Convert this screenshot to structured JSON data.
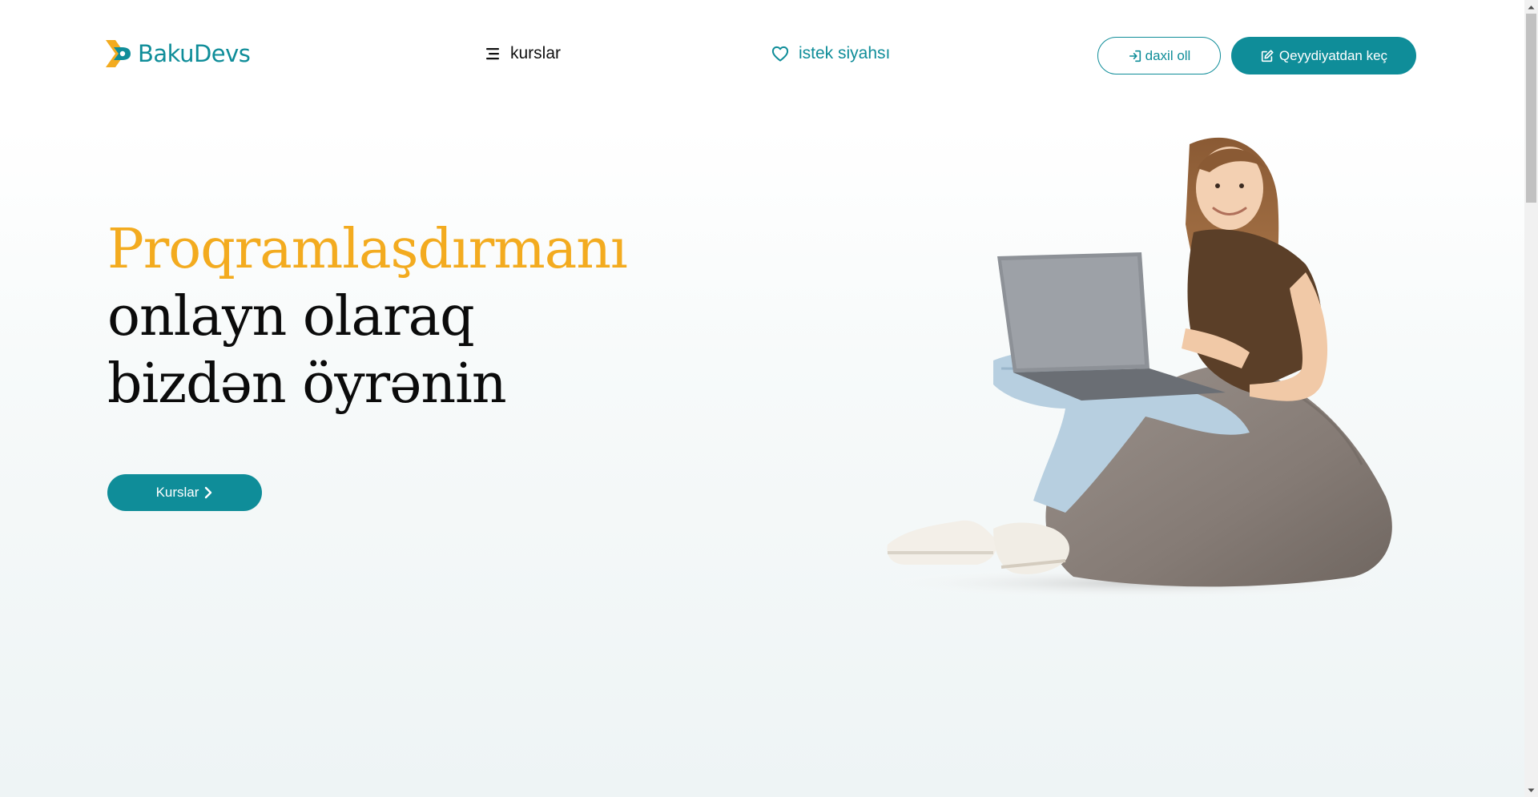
{
  "brand": {
    "name": "BakuDevs",
    "primary_color": "#0f8d99",
    "accent_color": "#f3ab1f"
  },
  "header": {
    "courses_label": "kurslar",
    "courses_icon": "menu-icon",
    "wishlist_label": "istek siyahsı",
    "wishlist_icon": "heart-icon",
    "login_label": "daxil oll",
    "login_icon": "sign-in-icon",
    "register_label": "Qeyydiyatdan keç",
    "register_icon": "edit-icon"
  },
  "hero": {
    "title_line1": "Proqramlaşdırmanı",
    "title_line2": "onlayn olaraq",
    "title_line3": "bizdən öyrənin",
    "cta_label": "Kurslar",
    "cta_icon": "chevron-right-icon",
    "illustration": "girl-with-laptop-on-beanbag"
  }
}
